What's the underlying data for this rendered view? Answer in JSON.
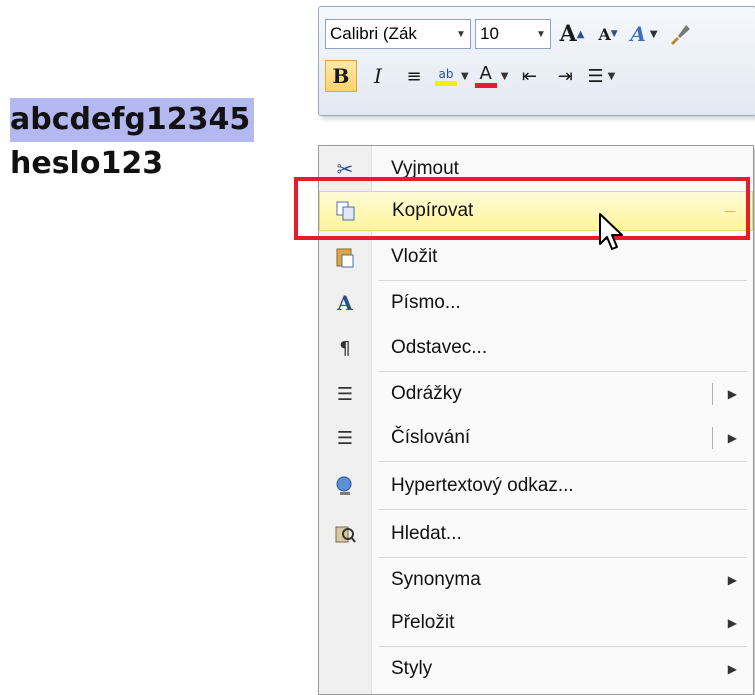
{
  "document": {
    "selected_text": "abcdefg12345",
    "line2_text": "heslo123"
  },
  "mini_toolbar": {
    "font_name": "Calibri (Zák",
    "font_size": "10",
    "grow_font": "A",
    "shrink_font": "A",
    "styles_glyph": "A",
    "bold": "B",
    "italic": "I",
    "highlight_glyph": "ab",
    "font_color_glyph": "A"
  },
  "context_menu": {
    "items": [
      {
        "label": "Vyjmout",
        "icon": "scissors-icon"
      },
      {
        "label": "Kopírovat",
        "icon": "copy-icon",
        "highlighted": true
      },
      {
        "label": "Vložit",
        "icon": "paste-icon"
      },
      {
        "label": "Písmo...",
        "icon": "font-icon"
      },
      {
        "label": "Odstavec...",
        "icon": "paragraph-icon"
      },
      {
        "label": "Odrážky",
        "icon": "bullets-icon",
        "submenu": true
      },
      {
        "label": "Číslování",
        "icon": "numbering-icon",
        "submenu": true
      },
      {
        "label": "Hypertextový odkaz...",
        "icon": "hyperlink-icon"
      },
      {
        "label": "Hledat...",
        "icon": "research-icon"
      },
      {
        "label": "Synonyma",
        "icon": "",
        "submenu": true
      },
      {
        "label": "Přeložit",
        "icon": "",
        "submenu": true
      },
      {
        "label": "Styly",
        "icon": "",
        "submenu": true
      }
    ]
  },
  "colors": {
    "selection": "#b4b8f0",
    "menu_highlight": "#fff59a",
    "annotation_box": "#e31e24",
    "font_color_bar": "#e31e24",
    "highlight_bar": "#f2f200"
  }
}
